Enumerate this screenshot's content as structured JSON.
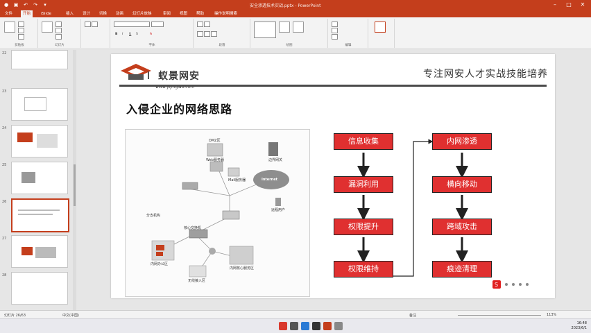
{
  "window": {
    "title": "安全渗透技术实战.pptx - PowerPoint"
  },
  "ribbon_tabs": [
    "文件",
    "开始",
    "iSlide",
    "插入",
    "设计",
    "切换",
    "动画",
    "幻灯片放映",
    "审阅",
    "视图",
    "帮助",
    "操作说明搜索"
  ],
  "ribbon_groups": [
    "剪贴板",
    "幻灯片",
    "字体",
    "段落",
    "绘图",
    "编辑"
  ],
  "thumbnail_numbers": [
    "22",
    "23",
    "24",
    "25",
    "26",
    "27",
    "28"
  ],
  "slide": {
    "brand_name": "蚁景网安",
    "brand_url": "www.yijinglab.com",
    "tagline": "专注网安人才实战技能培养",
    "title": "入侵企业的网络思路",
    "diagram_labels": {
      "dmz": "DMZ区",
      "web_server": "Web服务器",
      "mail_server": "Mail服务器",
      "gateway": "边界网关",
      "internet": "Internet",
      "remote_user": "远程用户",
      "branch": "分支机构",
      "office": "内网办公区",
      "core_switch": "核心交换机",
      "core_servers": "内网核心服务区",
      "guest": "无线接入区"
    },
    "flow_left": [
      "信息收集",
      "漏洞利用",
      "权限提升",
      "权限维持"
    ],
    "flow_right": [
      "内网渗透",
      "横向移动",
      "跨域攻击",
      "痕迹清理"
    ]
  },
  "statusbar": {
    "slide_info": "幻灯片 26/63",
    "language": "中文(中国)",
    "notes": "备注",
    "zoom": "113%"
  },
  "taskbar": {
    "time": "16:48",
    "date": "2023/6/1"
  },
  "colors": {
    "accent": "#c43e1c",
    "flow_box": "#e03030"
  }
}
